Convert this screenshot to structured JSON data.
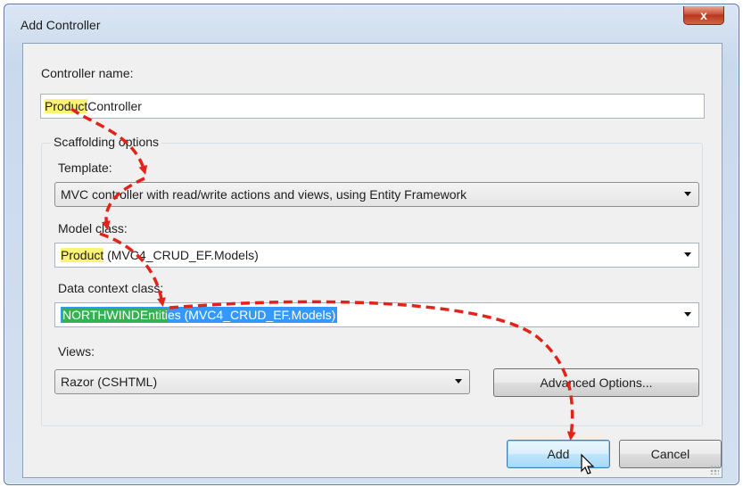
{
  "window": {
    "title": "Add Controller",
    "close_glyph": "x"
  },
  "controller_name": {
    "label": "Controller name:",
    "value_highlight": "Product",
    "value_rest": "Controller"
  },
  "scaffolding": {
    "caption": "Scaffolding options",
    "template": {
      "label": "Template:",
      "value": "MVC controller with read/write actions and views, using Entity Framework"
    },
    "model_class": {
      "label": "Model class:",
      "value_highlight": "Product",
      "value_rest": " (MVC4_CRUD_EF.Models)"
    },
    "data_context": {
      "label": "Data context class:",
      "value_highlight": "NORTHWINDEntiti",
      "value_rest": "es (MVC4_CRUD_EF.Models)"
    },
    "views": {
      "label": "Views:",
      "value": "Razor (CSHTML)"
    },
    "advanced_button": "Advanced Options..."
  },
  "buttons": {
    "add": "Add",
    "cancel": "Cancel"
  },
  "colors": {
    "highlight_yellow": "#fbf276",
    "highlight_green": "#32b350",
    "selection_blue": "#3399ff",
    "arrow_red": "#e2231a"
  },
  "icons": [
    "close-icon",
    "dropdown-arrow-icon",
    "mouse-cursor-icon",
    "resize-grip-icon"
  ]
}
